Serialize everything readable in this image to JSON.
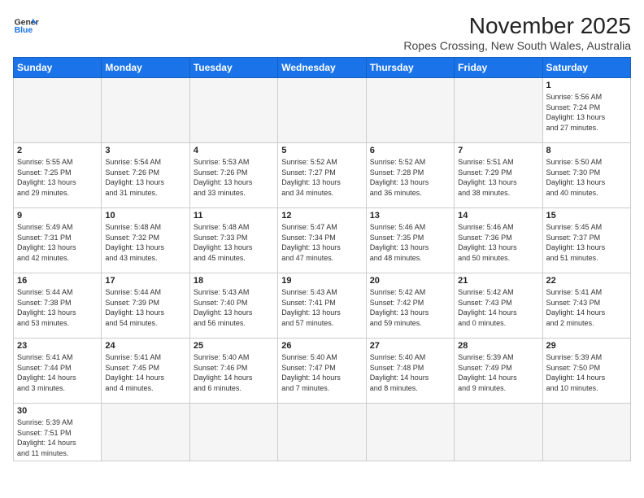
{
  "header": {
    "logo_line1": "General",
    "logo_line2": "Blue",
    "month_title": "November 2025",
    "location": "Ropes Crossing, New South Wales, Australia"
  },
  "weekdays": [
    "Sunday",
    "Monday",
    "Tuesday",
    "Wednesday",
    "Thursday",
    "Friday",
    "Saturday"
  ],
  "weeks": [
    [
      {
        "day": "",
        "info": ""
      },
      {
        "day": "",
        "info": ""
      },
      {
        "day": "",
        "info": ""
      },
      {
        "day": "",
        "info": ""
      },
      {
        "day": "",
        "info": ""
      },
      {
        "day": "",
        "info": ""
      },
      {
        "day": "1",
        "info": "Sunrise: 5:56 AM\nSunset: 7:24 PM\nDaylight: 13 hours\nand 27 minutes."
      }
    ],
    [
      {
        "day": "2",
        "info": "Sunrise: 5:55 AM\nSunset: 7:25 PM\nDaylight: 13 hours\nand 29 minutes."
      },
      {
        "day": "3",
        "info": "Sunrise: 5:54 AM\nSunset: 7:26 PM\nDaylight: 13 hours\nand 31 minutes."
      },
      {
        "day": "4",
        "info": "Sunrise: 5:53 AM\nSunset: 7:26 PM\nDaylight: 13 hours\nand 33 minutes."
      },
      {
        "day": "5",
        "info": "Sunrise: 5:52 AM\nSunset: 7:27 PM\nDaylight: 13 hours\nand 34 minutes."
      },
      {
        "day": "6",
        "info": "Sunrise: 5:52 AM\nSunset: 7:28 PM\nDaylight: 13 hours\nand 36 minutes."
      },
      {
        "day": "7",
        "info": "Sunrise: 5:51 AM\nSunset: 7:29 PM\nDaylight: 13 hours\nand 38 minutes."
      },
      {
        "day": "8",
        "info": "Sunrise: 5:50 AM\nSunset: 7:30 PM\nDaylight: 13 hours\nand 40 minutes."
      }
    ],
    [
      {
        "day": "9",
        "info": "Sunrise: 5:49 AM\nSunset: 7:31 PM\nDaylight: 13 hours\nand 42 minutes."
      },
      {
        "day": "10",
        "info": "Sunrise: 5:48 AM\nSunset: 7:32 PM\nDaylight: 13 hours\nand 43 minutes."
      },
      {
        "day": "11",
        "info": "Sunrise: 5:48 AM\nSunset: 7:33 PM\nDaylight: 13 hours\nand 45 minutes."
      },
      {
        "day": "12",
        "info": "Sunrise: 5:47 AM\nSunset: 7:34 PM\nDaylight: 13 hours\nand 47 minutes."
      },
      {
        "day": "13",
        "info": "Sunrise: 5:46 AM\nSunset: 7:35 PM\nDaylight: 13 hours\nand 48 minutes."
      },
      {
        "day": "14",
        "info": "Sunrise: 5:46 AM\nSunset: 7:36 PM\nDaylight: 13 hours\nand 50 minutes."
      },
      {
        "day": "15",
        "info": "Sunrise: 5:45 AM\nSunset: 7:37 PM\nDaylight: 13 hours\nand 51 minutes."
      }
    ],
    [
      {
        "day": "16",
        "info": "Sunrise: 5:44 AM\nSunset: 7:38 PM\nDaylight: 13 hours\nand 53 minutes."
      },
      {
        "day": "17",
        "info": "Sunrise: 5:44 AM\nSunset: 7:39 PM\nDaylight: 13 hours\nand 54 minutes."
      },
      {
        "day": "18",
        "info": "Sunrise: 5:43 AM\nSunset: 7:40 PM\nDaylight: 13 hours\nand 56 minutes."
      },
      {
        "day": "19",
        "info": "Sunrise: 5:43 AM\nSunset: 7:41 PM\nDaylight: 13 hours\nand 57 minutes."
      },
      {
        "day": "20",
        "info": "Sunrise: 5:42 AM\nSunset: 7:42 PM\nDaylight: 13 hours\nand 59 minutes."
      },
      {
        "day": "21",
        "info": "Sunrise: 5:42 AM\nSunset: 7:43 PM\nDaylight: 14 hours\nand 0 minutes."
      },
      {
        "day": "22",
        "info": "Sunrise: 5:41 AM\nSunset: 7:43 PM\nDaylight: 14 hours\nand 2 minutes."
      }
    ],
    [
      {
        "day": "23",
        "info": "Sunrise: 5:41 AM\nSunset: 7:44 PM\nDaylight: 14 hours\nand 3 minutes."
      },
      {
        "day": "24",
        "info": "Sunrise: 5:41 AM\nSunset: 7:45 PM\nDaylight: 14 hours\nand 4 minutes."
      },
      {
        "day": "25",
        "info": "Sunrise: 5:40 AM\nSunset: 7:46 PM\nDaylight: 14 hours\nand 6 minutes."
      },
      {
        "day": "26",
        "info": "Sunrise: 5:40 AM\nSunset: 7:47 PM\nDaylight: 14 hours\nand 7 minutes."
      },
      {
        "day": "27",
        "info": "Sunrise: 5:40 AM\nSunset: 7:48 PM\nDaylight: 14 hours\nand 8 minutes."
      },
      {
        "day": "28",
        "info": "Sunrise: 5:39 AM\nSunset: 7:49 PM\nDaylight: 14 hours\nand 9 minutes."
      },
      {
        "day": "29",
        "info": "Sunrise: 5:39 AM\nSunset: 7:50 PM\nDaylight: 14 hours\nand 10 minutes."
      }
    ],
    [
      {
        "day": "30",
        "info": "Sunrise: 5:39 AM\nSunset: 7:51 PM\nDaylight: 14 hours\nand 11 minutes."
      },
      {
        "day": "",
        "info": ""
      },
      {
        "day": "",
        "info": ""
      },
      {
        "day": "",
        "info": ""
      },
      {
        "day": "",
        "info": ""
      },
      {
        "day": "",
        "info": ""
      },
      {
        "day": "",
        "info": ""
      }
    ]
  ]
}
